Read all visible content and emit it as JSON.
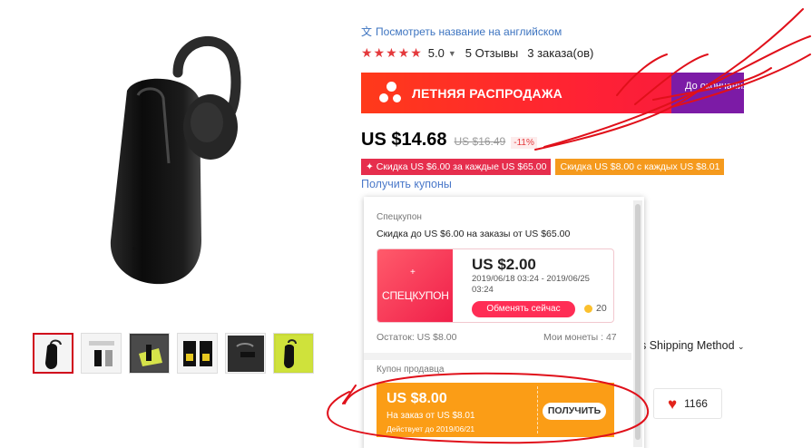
{
  "product": {
    "translate_link": "Посмотреть название на английском",
    "rating": "5.0",
    "reviews": "5 Отзывы",
    "orders": "3 заказа(ов)"
  },
  "sale_banner": {
    "title": "ЛЕТНЯЯ РАСПРОДАЖА",
    "right_text": "До окончания"
  },
  "price": {
    "current": "US $14.68",
    "old": "US $16.49",
    "discount": "-11%"
  },
  "promos": [
    {
      "label": "✦ Скидка US $6.00 за каждые US $65.00"
    },
    {
      "label": "Скидка US $8.00 с каждых US $8.01"
    }
  ],
  "coupon_link": "Получить купоны",
  "popup": {
    "section_title": "Спецкупон",
    "description": "Скидка до US $6.00 на заказы от US $65.00",
    "card": {
      "plus": "+",
      "label": "СПЕЦКУПОН",
      "amount": "US $2.00",
      "dates": "2019/06/18 03:24 - 2019/06/25 03:24",
      "button": "Обменять сейчас",
      "coin_cost": "20"
    },
    "remaining": "Остаток: US $8.00",
    "my_coins": "Мои монеты : 47",
    "section2_title": "Купон продавца",
    "store_coupon": {
      "amount": "US $8.00",
      "condition": "На заказ от  US $8.01",
      "expires": "Действует до 2019/06/21",
      "button": "ПОЛУЧИТЬ"
    }
  },
  "shipping": "s Shipping Method",
  "wishlist_count": "1166",
  "colors": {
    "accent_red": "#e62e4d",
    "accent_orange": "#fb9d16",
    "link_blue": "#3d74c0",
    "annotation_red": "#e0101a"
  }
}
